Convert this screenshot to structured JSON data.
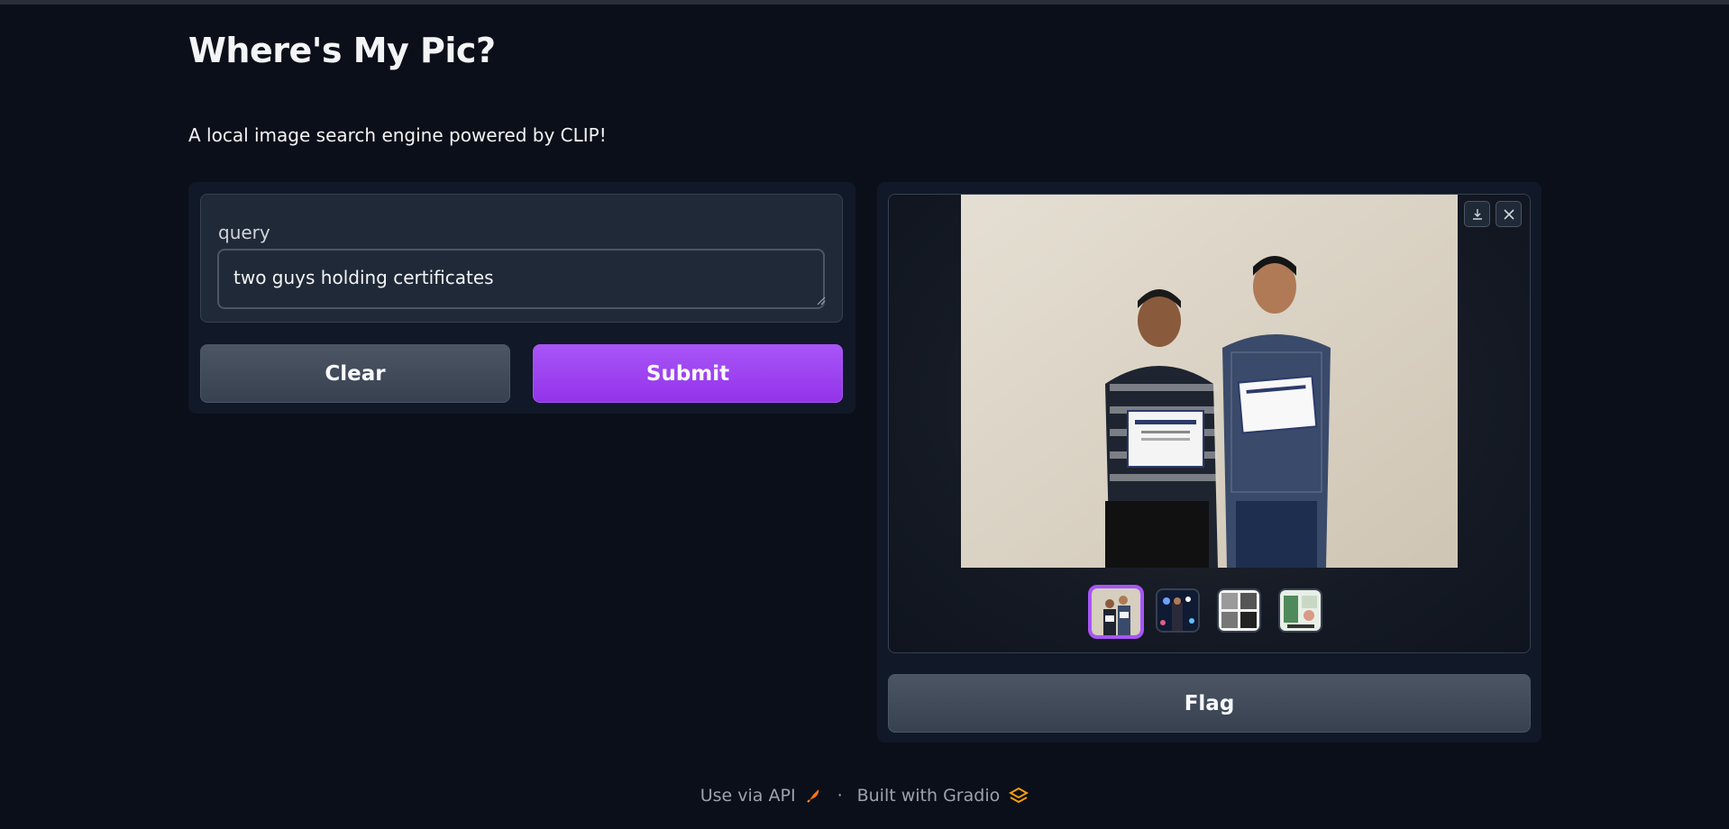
{
  "app": {
    "title": "Where's My Pic?",
    "description": "A local image search engine powered by CLIP!"
  },
  "query": {
    "label": "query",
    "value": "two guys holding certificates",
    "placeholder": ""
  },
  "buttons": {
    "clear": "Clear",
    "submit": "Submit",
    "flag": "Flag"
  },
  "gallery": {
    "selected_index": 0,
    "thumbnail_count": 4,
    "icons": [
      "download-icon",
      "close-icon"
    ]
  },
  "footer": {
    "api_link": "Use via API",
    "separator": "·",
    "built_with": "Built with Gradio"
  },
  "colors": {
    "background": "#0b0f19",
    "panel": "#111827",
    "accent": "#a855f7",
    "secondary_button": "#4b5563"
  }
}
